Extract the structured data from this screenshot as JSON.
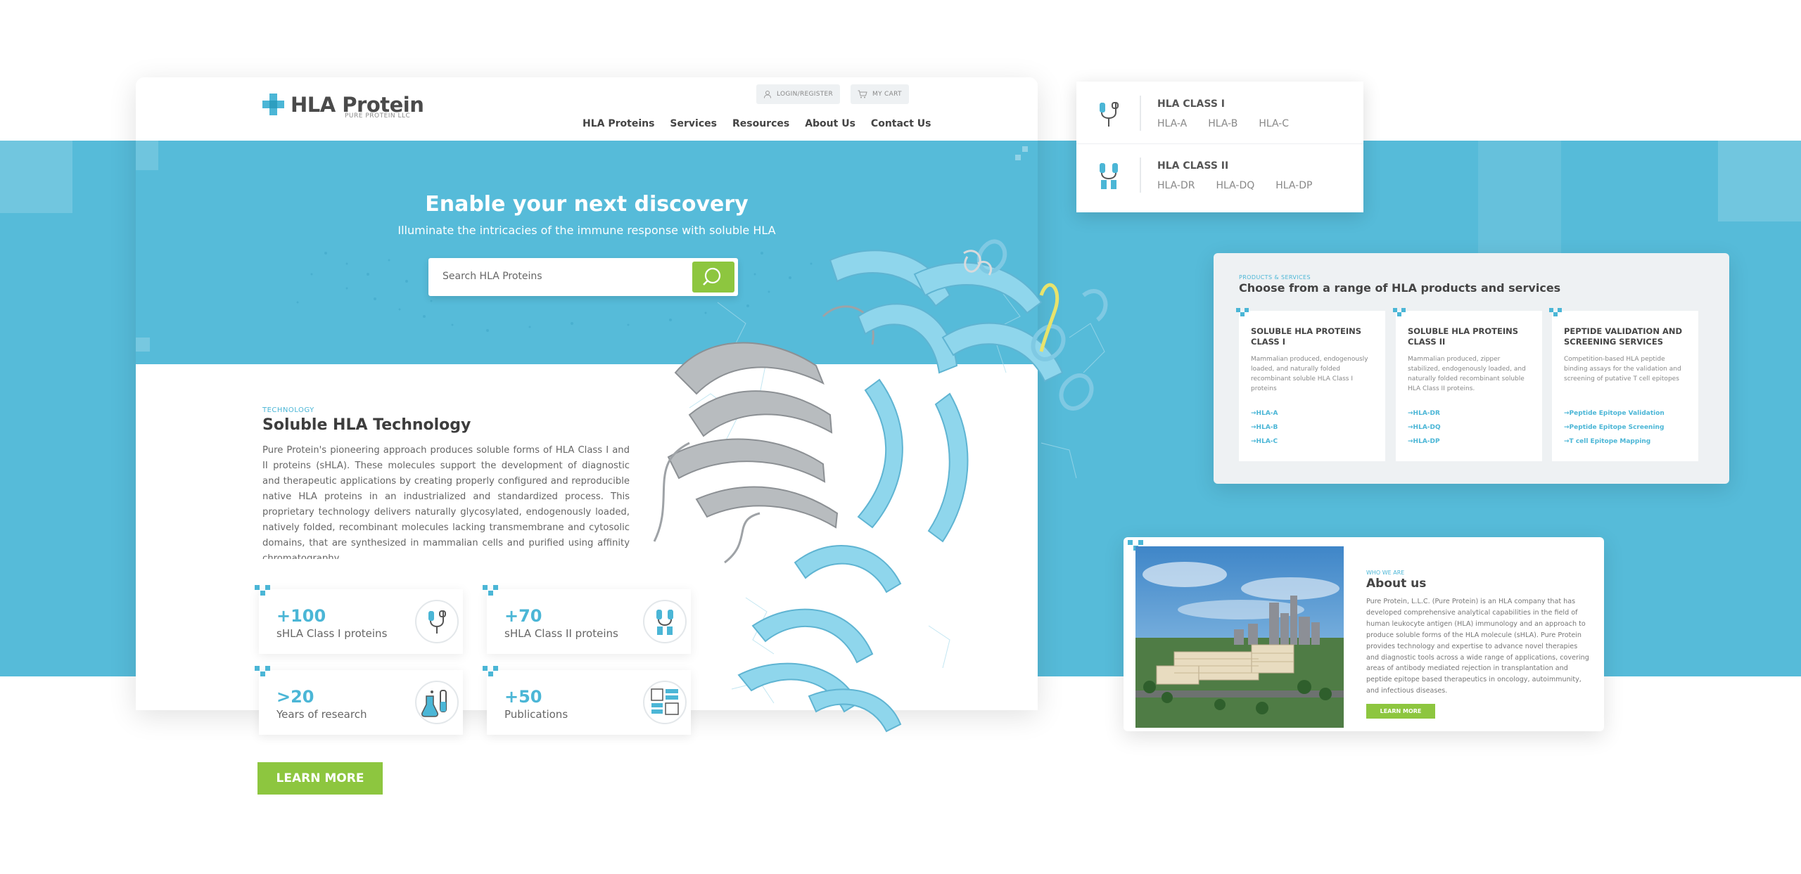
{
  "site": {
    "brand": "HLA Protein",
    "brand_sub": "PURE PROTEIN LLC",
    "login_label": "LOGIN/REGISTER",
    "cart_label": "MY CART",
    "nav": [
      "HLA Proteins",
      "Services",
      "Resources",
      "About Us",
      "Contact Us"
    ]
  },
  "hero": {
    "title": "Enable your next discovery",
    "subtitle": "Illuminate the intricacies of the immune response with soluble HLA",
    "search_placeholder": "Search HLA Proteins"
  },
  "technology": {
    "tag": "TECHNOLOGY",
    "title": "Soluble HLA Technology",
    "body": "Pure Protein's pioneering approach produces soluble forms of HLA Class I and II proteins (sHLA). These molecules support the development of diagnostic and therapeutic applications by creating properly configured and reproducible native HLA proteins in an industrialized and standardized process. This proprietary technology delivers naturally glycosylated, endogenously loaded, natively folded, recombinant molecules lacking transmembrane and cytosolic domains, that are synthesized in mammalian cells and purified using affinity chromatography.",
    "learn_more": "LEARN MORE"
  },
  "stats": [
    {
      "value": "+100",
      "label": "sHLA Class I proteins",
      "icon": "hla-class-1-icon"
    },
    {
      "value": "+70",
      "label": "sHLA Class II proteins",
      "icon": "hla-class-2-icon"
    },
    {
      "value": ">20",
      "label": "Years of research",
      "icon": "lab-flask-icon"
    },
    {
      "value": "+50",
      "label": "Publications",
      "icon": "publication-icon"
    }
  ],
  "dropdown": {
    "class1_title": "HLA CLASS I",
    "class1_links": [
      "HLA-A",
      "HLA-B",
      "HLA-C"
    ],
    "class2_title": "HLA CLASS II",
    "class2_links": [
      "HLA-DR",
      "HLA-DQ",
      "HLA-DP"
    ]
  },
  "products": {
    "tag": "PRODUCTS & SERVICES",
    "title": "Choose from a range of HLA products and services",
    "cards": [
      {
        "title": "SOLUBLE HLA PROTEINS CLASS I",
        "desc": "Mammalian produced, endogenously loaded, and naturally folded recombinant soluble HLA Class I proteins",
        "links": [
          "HLA-A",
          "HLA-B",
          "HLA-C"
        ]
      },
      {
        "title": "SOLUBLE HLA PROTEINS CLASS II",
        "desc": "Mammalian produced, zipper stabilized, endogenously loaded, and naturally folded recombinant soluble HLA Class II proteins.",
        "links": [
          "HLA-DR",
          "HLA-DQ",
          "HLA-DP"
        ]
      },
      {
        "title": "PEPTIDE VALIDATION AND SCREENING SERVICES",
        "desc": "Competition-based HLA peptide binding assays for the validation and screening of putative T cell epitopes",
        "links": [
          "Peptide Epitope Validation",
          "Peptide Epitope Screening",
          "T cell Epitope Mapping"
        ]
      }
    ]
  },
  "about": {
    "tag": "WHO WE ARE",
    "title": "About us",
    "body": "Pure Protein, L.L.C. (Pure Protein) is an HLA company that has developed comprehensive analytical capabilities in the field of human leukocyte antigen (HLA) immunology and an approach to produce soluble forms of the HLA molecule (sHLA). Pure Protein provides technology and expertise to advance novel therapies and diagnostic tools across a wide range of applications, covering areas of antibody mediated rejection in transplantation and peptide epitope based therapeutics in oncology, autoimmunity, and infectious diseases.",
    "button": "LEARN MORE"
  },
  "colors": {
    "accent": "#56bbd9",
    "accent_dark": "#4bb6d6",
    "cta": "#8dc63f",
    "text": "#444444"
  }
}
